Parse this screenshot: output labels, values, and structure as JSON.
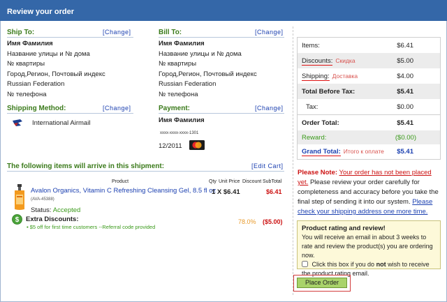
{
  "header": {
    "title": "Review your order"
  },
  "ship_to": {
    "heading": "Ship To:",
    "change": "[Change]",
    "lines": [
      "Имя Фамилия",
      "Название улицы и № дома",
      "№ квартиры",
      "Город,Регион, Почтовый индекс",
      "Russian Federation",
      "№ телефона"
    ]
  },
  "bill_to": {
    "heading": "Bill To:",
    "change": "[Change]",
    "lines": [
      "Имя Фамилия",
      "Название улицы и № дома",
      "№ квартиры",
      "Город,Регион, Почтовый индекс",
      "Russian Federation",
      "№ телефона"
    ]
  },
  "shipping_method": {
    "heading": "Shipping Method:",
    "change": "[Change]",
    "name": "International Airmail"
  },
  "payment": {
    "heading": "Payment:",
    "change": "[Change]",
    "name": "Имя Фамилия",
    "card": "xxxx-xxxx-xxxx-1301",
    "expiry": "12/2011"
  },
  "shipment": {
    "heading": "The following items will arrive in this shipment:",
    "edit": "[Edit Cart]",
    "columns": {
      "product": "Product",
      "qty": "Qty",
      "unit_price": "Unit Price",
      "discount": "Discount",
      "subtotal": "SubTotal"
    },
    "item": {
      "name": "Avalon Organics, Vitamin C Refreshing Cleansing Gel, 8.5 fl oz",
      "code": "(AVA-45388)",
      "qty_price": "1 X $6.41",
      "subtotal": "$6.41",
      "status_label": "Status:",
      "status": "Accepted"
    },
    "extra": {
      "label": "Extra Discounts:",
      "description": "$5 off for first time customers --Referral code provided",
      "percent": "78.0%",
      "amount": "($5.00)"
    }
  },
  "summary": {
    "items_label": "Items:",
    "items": "$6.41",
    "discounts_label": "Discounts:",
    "discounts_ru": "Скидка",
    "discounts": "$5.00",
    "shipping_label": "Shipping:",
    "shipping_ru": "Доставка",
    "shipping": "$4.00",
    "before_tax_label": "Total Before Tax:",
    "before_tax": "$5.41",
    "tax_label": "Tax:",
    "tax": "$0.00",
    "order_total_label": "Order Total:",
    "order_total": "$5.41",
    "reward_label": "Reward:",
    "reward": "($0.00)",
    "grand_total_label": "Grand Total:",
    "grand_total_ru": "Итого к оплате",
    "grand_total": "$5.41"
  },
  "note": {
    "label": "Please Note:",
    "warning": "Your order has not been placed yet.",
    "text": "Please review your order carefully for completeness and accuracy before you take the final step of sending it into our system.",
    "check": "Please check your shipping address one more time."
  },
  "rating": {
    "title": "Product rating and review!",
    "text": "You will receive an email in about 3 weeks to rate and review the product(s) you are ordering now.",
    "checkbox_pre": "Click this box if you do",
    "checkbox_bold": "not",
    "checkbox_post": "wish to receive the product rating email."
  },
  "place_order": "Place Order",
  "colors": {
    "header": "#3467a8",
    "section_heading": "#3a7a1a",
    "link": "#1a3fb0",
    "alert": "#cc1111",
    "button": "#a9d36a"
  }
}
